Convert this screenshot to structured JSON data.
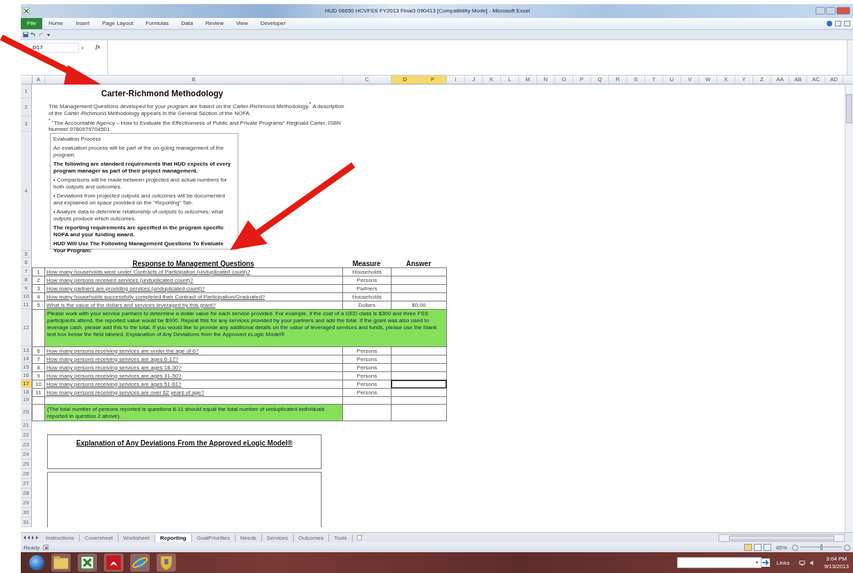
{
  "window": {
    "title": "HUD 06650 HCVFSS FY2013 Final3 090413 [Compatibility Mode] - Microsoft Excel"
  },
  "ribbon_tabs": [
    {
      "label": "File",
      "kind": "file"
    },
    {
      "label": "Home",
      "kind": "tab"
    },
    {
      "label": "Insert",
      "kind": "tab"
    },
    {
      "label": "Page Layout",
      "kind": "tab"
    },
    {
      "label": "Formulas",
      "kind": "tab"
    },
    {
      "label": "Data",
      "kind": "tab"
    },
    {
      "label": "Review",
      "kind": "tab"
    },
    {
      "label": "View",
      "kind": "tab"
    },
    {
      "label": "Developer",
      "kind": "tab"
    }
  ],
  "formula_bar": {
    "name_box": "D17",
    "fx": "fx"
  },
  "column_headers": [
    {
      "label": "A",
      "selected": false
    },
    {
      "label": "B",
      "selected": false
    },
    {
      "label": "C",
      "selected": false
    },
    {
      "label": "D",
      "selected": true
    },
    {
      "label": "F",
      "selected": true
    },
    {
      "label": "I",
      "selected": false
    },
    {
      "label": "J",
      "selected": false
    },
    {
      "label": "K",
      "selected": false
    },
    {
      "label": "L",
      "selected": false
    },
    {
      "label": "M",
      "selected": false
    },
    {
      "label": "N",
      "selected": false
    },
    {
      "label": "O",
      "selected": false
    },
    {
      "label": "P",
      "selected": false
    },
    {
      "label": "Q",
      "selected": false
    },
    {
      "label": "R",
      "selected": false
    },
    {
      "label": "S",
      "selected": false
    },
    {
      "label": "T",
      "selected": false
    },
    {
      "label": "U",
      "selected": false
    },
    {
      "label": "V",
      "selected": false
    },
    {
      "label": "W",
      "selected": false
    },
    {
      "label": "X",
      "selected": false
    },
    {
      "label": "Y",
      "selected": false
    },
    {
      "label": "Z",
      "selected": false
    },
    {
      "label": "AA",
      "selected": false
    },
    {
      "label": "AB",
      "selected": false
    },
    {
      "label": "AC",
      "selected": false
    },
    {
      "label": "AD",
      "selected": false
    }
  ],
  "row_headers": [
    {
      "label": "1",
      "selected": false
    },
    {
      "label": "2",
      "selected": false
    },
    {
      "label": "3",
      "selected": false
    },
    {
      "label": "4",
      "selected": false
    },
    {
      "label": "5",
      "selected": false
    },
    {
      "label": "6",
      "selected": false
    },
    {
      "label": "7",
      "selected": false
    },
    {
      "label": "8",
      "selected": false
    },
    {
      "label": "9",
      "selected": false
    },
    {
      "label": "10",
      "selected": false
    },
    {
      "label": "11",
      "selected": false
    },
    {
      "label": "12",
      "selected": false
    },
    {
      "label": "13",
      "selected": false
    },
    {
      "label": "14",
      "selected": false
    },
    {
      "label": "15",
      "selected": false
    },
    {
      "label": "16",
      "selected": false
    },
    {
      "label": "17",
      "selected": true
    },
    {
      "label": "18",
      "selected": false
    },
    {
      "label": "19",
      "selected": false
    },
    {
      "label": "20",
      "selected": false
    },
    {
      "label": "21",
      "selected": false
    },
    {
      "label": "22",
      "selected": false
    },
    {
      "label": "23",
      "selected": false
    },
    {
      "label": "24",
      "selected": false
    },
    {
      "label": "25",
      "selected": false
    },
    {
      "label": "26",
      "selected": false
    },
    {
      "label": "27",
      "selected": false
    },
    {
      "label": "28",
      "selected": false
    },
    {
      "label": "29",
      "selected": false
    },
    {
      "label": "30",
      "selected": false
    },
    {
      "label": "31",
      "selected": false
    }
  ],
  "sheet": {
    "title": "Carter-Richmond Methodology",
    "intro": "The Management Questions developed for your program are based on the Carter-Richmond Methodology.$^{*}$ A description of the Carter-Richmond Methodology appears in the General Section of the NOFA.",
    "footnote": "$^{*}$ \"The Accountable Agency – How to Evaluate the Effectiveness of Public and Private Programs\" Reginald Carter, ISBN Number 9780979704501",
    "evaluation_box": [
      {
        "text": "Evaluation Process",
        "bold": false
      },
      {
        "text": "An evaluation process will be part of the on-going management of the program.",
        "bold": false
      },
      {
        "text": "The following are standard requirements that HUD expects of every program manager as part of their project management.",
        "bold": true
      },
      {
        "text": "• Comparisons will be made between projected and actual numbers for both outputs and outcomes.",
        "bold": false
      },
      {
        "text": "• Deviations from projected outputs and outcomes will be documented and explained on space provided on the \"Reporting\" Tab.",
        "bold": false
      },
      {
        "text": "• Analyze data to determine relationship of outputs to outcomes; what outputs produce which outcomes.",
        "bold": false
      },
      {
        "text": "The reporting requirements are specified in the program specific NOFA and your funding award.",
        "bold": true
      },
      {
        "text": "HUD Will Use The Following Management Questions To Evaluate Your Program:",
        "bold": true
      }
    ],
    "table": {
      "title": "Response to Management Questions",
      "columns": [
        "Measure",
        "Answer"
      ],
      "rows": [
        {
          "kind": "question",
          "number": "1",
          "question": "How many households were under Contracts of Participation (unduplicated count)?",
          "measure": "Households",
          "selected": false
        },
        {
          "kind": "question",
          "number": "2",
          "question": "How many persons received services (unduplicated count)?",
          "measure": "Persons",
          "selected": false
        },
        {
          "kind": "question",
          "number": "3",
          "question": "How many partners are providing services (unduplicated count)?",
          "measure": "Partners",
          "selected": false
        },
        {
          "kind": "question",
          "number": "4",
          "question": "How many households successfully completed their Contract of Participation/Graduated?",
          "measure": "Households",
          "selected": false
        },
        {
          "kind": "question",
          "number": "5",
          "question": "What is the value of the dollars and services leveraged by this grant?",
          "measure": "Dollars",
          "answer": "$0.00",
          "selected": false
        },
        {
          "kind": "note",
          "text": "Please work with your service partners to determine a dollar value for each service provided. For example, if the cost of a GED class is $300 and three FSS participants attend, the reported value would be $900. Repeat this for any services provided by your partners and add the total. If the grant was also used to leverage cash, please add this to the total. If you would like to provide any additional details on the value of leveraged services and funds, please use the blank text box below the field labeled, Explanation of Any Deviations from the Approved eLogic Model®"
        },
        {
          "kind": "question",
          "number": "6",
          "question": "How many persons receiving services are under the age of 6?",
          "measure": "Persons",
          "selected": false
        },
        {
          "kind": "question",
          "number": "7",
          "question": "How many persons receiving services are ages 6-17?",
          "measure": "Persons",
          "selected": false
        },
        {
          "kind": "question",
          "number": "8",
          "question": "How many persons receiving services are ages 18-30?",
          "measure": "Persons",
          "selected": false
        },
        {
          "kind": "question",
          "number": "9",
          "question": "How many persons receiving services are ages 31-50?",
          "measure": "Persons",
          "selected": false
        },
        {
          "kind": "question",
          "number": "10",
          "question": "How many persons receiving services are ages 51-61?",
          "measure": "Persons",
          "selected": true
        },
        {
          "kind": "question",
          "number": "11",
          "question": "How many persons receiving services are over 62 years of age?",
          "measure": "Persons",
          "selected": false
        },
        {
          "kind": "blank"
        },
        {
          "kind": "total_note",
          "text": "(The total number of persons reported is questions 6-11 should equal the total number of unduplicated individuals reported in question 2 above)."
        }
      ]
    },
    "explanation_title": "Explanation of Any Deviations From the Approved eLogic Model®"
  },
  "sheet_tabs": [
    {
      "label": "Instructions",
      "selected": false
    },
    {
      "label": "Coversheet",
      "selected": false
    },
    {
      "label": "Worksheet",
      "selected": false
    },
    {
      "label": "Reporting",
      "selected": true
    },
    {
      "label": "GoalPriorities",
      "selected": false
    },
    {
      "label": "Needs",
      "selected": false
    },
    {
      "label": "Services",
      "selected": false
    },
    {
      "label": "Outcomes",
      "selected": false
    },
    {
      "label": "Tools",
      "selected": false
    }
  ],
  "status_bar": {
    "text": "Ready",
    "zoom": "85%",
    "zoom_slider": {
      "level": 0.5
    }
  },
  "taskbar": {
    "links": "Links",
    "time": "3:04 PM",
    "date": "9/13/2013"
  }
}
